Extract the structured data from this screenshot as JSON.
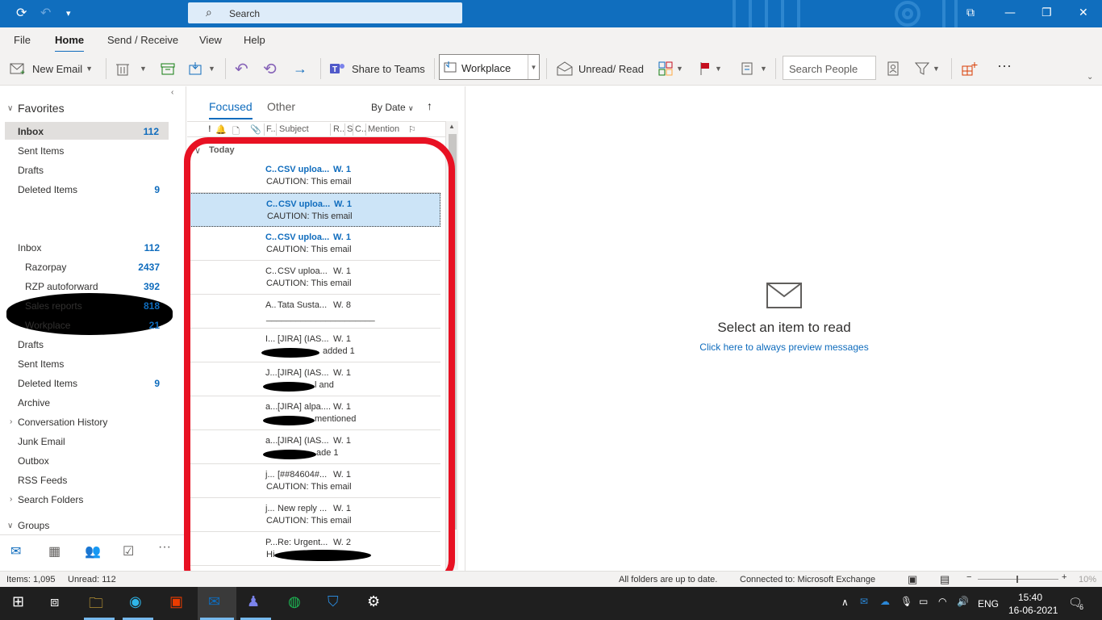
{
  "titlebar": {
    "search_label": "Search"
  },
  "menu": {
    "tabs": [
      "File",
      "Home",
      "Send / Receive",
      "View",
      "Help"
    ],
    "active": "Home"
  },
  "ribbon": {
    "new_email": "New Email",
    "share_to_teams": "Share to Teams",
    "move_to_folder": "Workplace",
    "unread_read": "Unread/ Read",
    "search_people_placeholder": "Search People",
    "more": "···"
  },
  "folders": {
    "favorites_header": "Favorites",
    "favorites": [
      {
        "name": "Inbox",
        "count": "112"
      },
      {
        "name": "Sent Items",
        "count": ""
      },
      {
        "name": "Drafts",
        "count": ""
      },
      {
        "name": "Deleted Items",
        "count": "9"
      }
    ],
    "account_inbox": {
      "name": "Inbox",
      "count": "112"
    },
    "account_subfolders": [
      {
        "name": "Razorpay",
        "count": "2437"
      },
      {
        "name": "RZP autoforward",
        "count": "392"
      },
      {
        "name": "Sales reports",
        "count": "818"
      },
      {
        "name": "Workplace",
        "count": "21"
      }
    ],
    "account_folders": [
      {
        "name": "Drafts",
        "count": ""
      },
      {
        "name": "Sent Items",
        "count": ""
      },
      {
        "name": "Deleted Items",
        "count": "9"
      },
      {
        "name": "Archive",
        "count": ""
      },
      {
        "name": "Conversation History",
        "count": ""
      },
      {
        "name": "Junk Email",
        "count": ""
      },
      {
        "name": "Outbox",
        "count": ""
      },
      {
        "name": "RSS Feeds",
        "count": ""
      },
      {
        "name": "Search Folders",
        "count": ""
      }
    ],
    "groups_header": "Groups"
  },
  "message_list": {
    "tabs": [
      "Focused",
      "Other"
    ],
    "active_tab": "Focused",
    "sort": "By Date",
    "columns": [
      "!",
      "F..",
      "Subject",
      "R..",
      "S",
      "C..",
      "Mention"
    ],
    "group": "Today",
    "rows": [
      {
        "from": "C..",
        "subject": "CSV uploa...",
        "date": "W. 1",
        "preview": "CAUTION: This email",
        "unread": true,
        "selected": false
      },
      {
        "from": "C..",
        "subject": "CSV uploa...",
        "date": "W. 1",
        "preview": "CAUTION: This email",
        "unread": true,
        "selected": true
      },
      {
        "from": "C..",
        "subject": "CSV uploa...",
        "date": "W. 1",
        "preview": "CAUTION: This email",
        "unread": true,
        "selected": false
      },
      {
        "from": "C..",
        "subject": "CSV uploa...",
        "date": "W. 1",
        "preview": "CAUTION: This email",
        "unread": false,
        "selected": false
      },
      {
        "from": "A..",
        "subject": "Tata Susta...",
        "date": "W. 8",
        "preview": "______________________",
        "unread": false,
        "selected": false
      },
      {
        "from": "I...",
        "subject": "[JIRA] (IAS...",
        "date": "W. 1",
        "preview": "added 1",
        "unread": false,
        "selected": false
      },
      {
        "from": "J...",
        "subject": "[JIRA] (IAS...",
        "date": "W. 1",
        "preview": "l and",
        "unread": false,
        "selected": false
      },
      {
        "from": "a...",
        "subject": "[JIRA] alpa....",
        "date": "W. 1",
        "preview": "mentioned",
        "unread": false,
        "selected": false
      },
      {
        "from": "a...",
        "subject": "[JIRA] (IAS...",
        "date": "W. 1",
        "preview": "ade 1",
        "unread": false,
        "selected": false
      },
      {
        "from": "j...",
        "subject": "[##84604#...",
        "date": "W. 1",
        "preview": "CAUTION: This email",
        "unread": false,
        "selected": false
      },
      {
        "from": "j...",
        "subject": "New reply ...",
        "date": "W. 1",
        "preview": "CAUTION: This email",
        "unread": false,
        "selected": false
      },
      {
        "from": "P...",
        "subject": "Re: Urgent...",
        "date": "W. 2",
        "preview": "Hi",
        "unread": false,
        "selected": false
      }
    ]
  },
  "reading_pane": {
    "title": "Select an item to read",
    "link": "Click here to always preview messages"
  },
  "status": {
    "items": "Items: 1,095",
    "unread": "Unread: 112",
    "sync": "All folders are up to date.",
    "connection": "Connected to: Microsoft Exchange",
    "zoom": "10%"
  },
  "taskbar": {
    "lang": "ENG",
    "time": "15:40",
    "date": "16-06-2021",
    "notifications": "6"
  },
  "colors": {
    "titlebar": "#106ebe",
    "accent": "#0f6cbd",
    "annotation": "#e81123"
  }
}
